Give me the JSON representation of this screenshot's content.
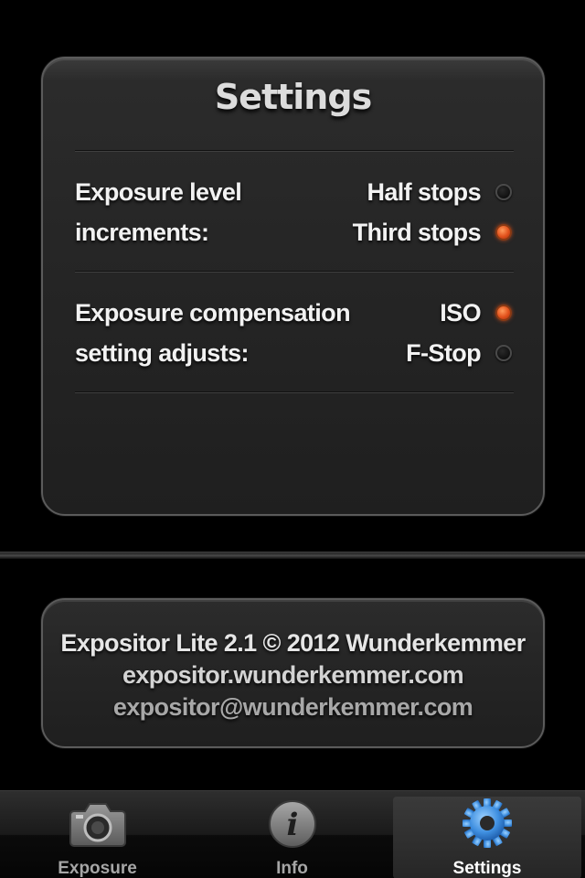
{
  "settings": {
    "title": "Settings",
    "groups": [
      {
        "label_lines": [
          "Exposure level",
          "increments:"
        ],
        "options": [
          {
            "label": "Half stops",
            "selected": false
          },
          {
            "label": "Third stops",
            "selected": true
          }
        ]
      },
      {
        "label_lines": [
          "Exposure compensation",
          "setting adjusts:"
        ],
        "options": [
          {
            "label": "ISO",
            "selected": true
          },
          {
            "label": "F-Stop",
            "selected": false
          }
        ]
      }
    ]
  },
  "about": {
    "line1": "Expositor Lite 2.1 © 2012 Wunderkemmer",
    "line2": "expositor.wunderkemmer.com",
    "line3": "expositor@wunderkemmer.com"
  },
  "tabbar": {
    "tabs": [
      {
        "label": "Exposure",
        "icon": "camera-icon",
        "selected": false
      },
      {
        "label": "Info",
        "icon": "info-icon",
        "selected": false
      },
      {
        "label": "Settings",
        "icon": "gear-icon",
        "selected": true
      }
    ]
  },
  "colors": {
    "accent_radio_on": "#e2511c",
    "gear_blue": "#3f8fe0"
  }
}
